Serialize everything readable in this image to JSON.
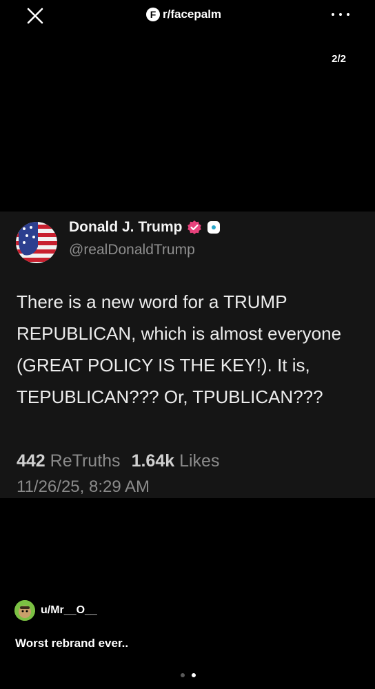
{
  "header": {
    "subreddit": "r/facepalm",
    "subreddit_icon_letter": "F",
    "close_icon": "close-icon",
    "more_icon": "more-icon"
  },
  "gallery": {
    "counter": "2/2",
    "current_index": 2,
    "total": 2
  },
  "post": {
    "author_name": "Donald J. Trump",
    "handle": "@realDonaldTrump",
    "verified_color": "#e8427c",
    "body": "There is a new word for a TRUMP REPUBLICAN, which is almost everyone (GREAT POLICY IS THE KEY!). It is, TEPUBLICAN??? Or, TPUBLICAN???",
    "retruths_count": "442",
    "retruths_label": "ReTruths",
    "likes_count": "1.64k",
    "likes_label": "Likes",
    "date": "11/26/25, 8:29 AM"
  },
  "reddit": {
    "username": "u/Mr__O__",
    "caption": "Worst rebrand ever.."
  }
}
